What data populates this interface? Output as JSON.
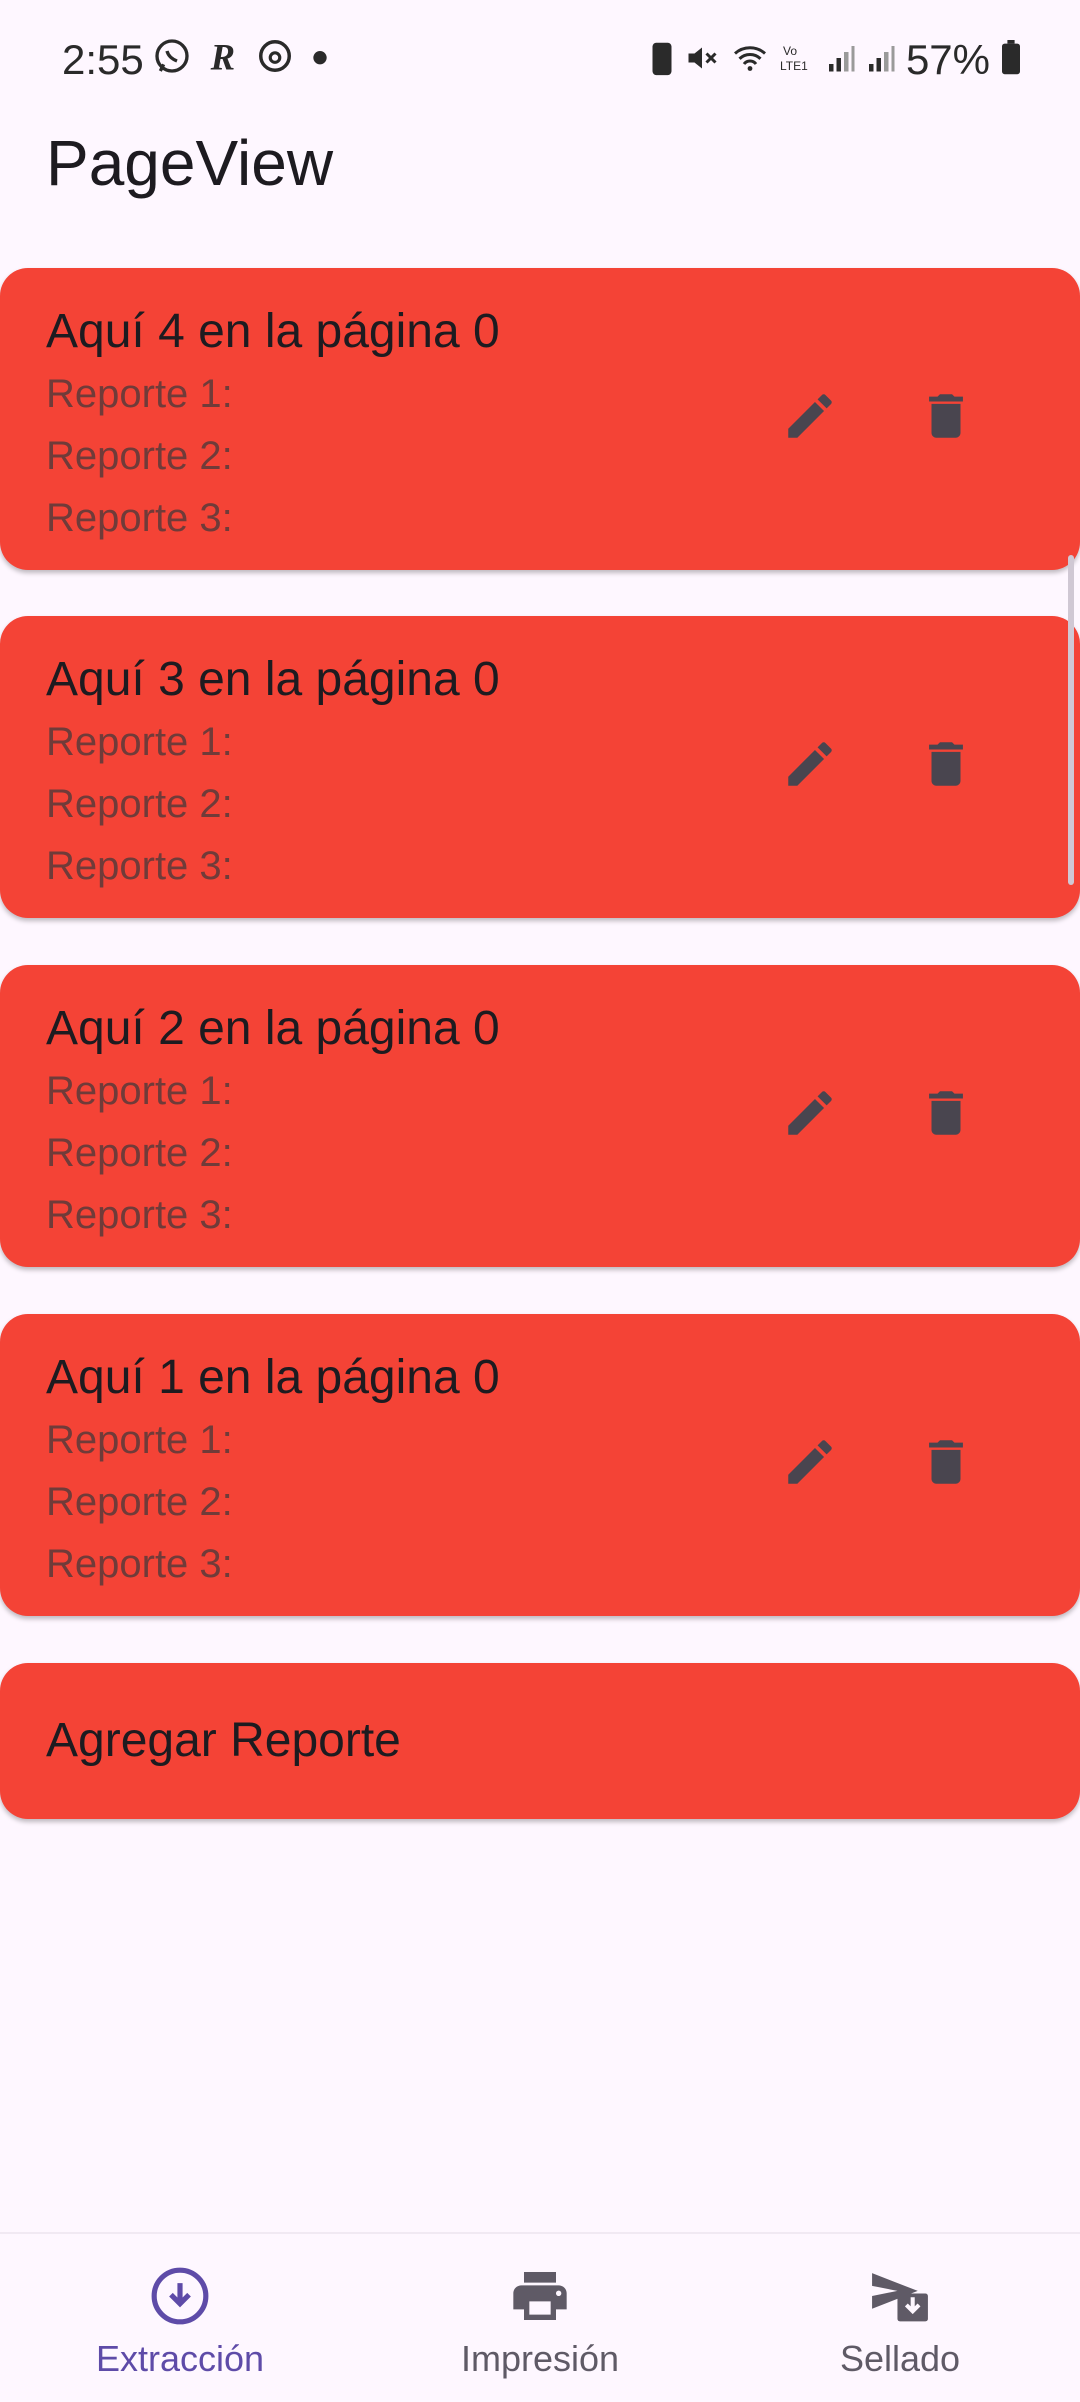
{
  "status_bar": {
    "time": "2:55",
    "battery": "57%",
    "notification_icons": [
      "whatsapp-icon",
      "r-app-icon",
      "threads-icon",
      "dot-icon"
    ],
    "system_icons": [
      "battery-saver-icon",
      "mute-icon",
      "wifi-icon",
      "volte-icon",
      "signal-icon",
      "signal-icon",
      "battery-icon"
    ]
  },
  "app_bar": {
    "title": "PageView"
  },
  "reports": [
    {
      "title": "Aquí 4 en la página 0",
      "lines": [
        "Reporte 1:",
        "Reporte 2:",
        "Reporte 3:"
      ]
    },
    {
      "title": "Aquí 3 en la página 0",
      "lines": [
        "Reporte 1:",
        "Reporte 2:",
        "Reporte 3:"
      ]
    },
    {
      "title": "Aquí 2 en la página 0",
      "lines": [
        "Reporte 1:",
        "Reporte 2:",
        "Reporte 3:"
      ]
    },
    {
      "title": "Aquí 1 en la página 0",
      "lines": [
        "Reporte 1:",
        "Reporte 2:",
        "Reporte 3:"
      ]
    }
  ],
  "add_report": {
    "label": "Agregar Reporte"
  },
  "bottom_nav": {
    "items": [
      {
        "label": "Extracción",
        "icon": "download-circle-icon",
        "active": true
      },
      {
        "label": "Impresión",
        "icon": "printer-icon",
        "active": false
      },
      {
        "label": "Sellado",
        "icon": "send-inbox-icon",
        "active": false
      }
    ]
  },
  "colors": {
    "background": "#FEF7FF",
    "card": "#F44336",
    "icon": "#49454F",
    "active_nav": "#5E4BA8"
  }
}
